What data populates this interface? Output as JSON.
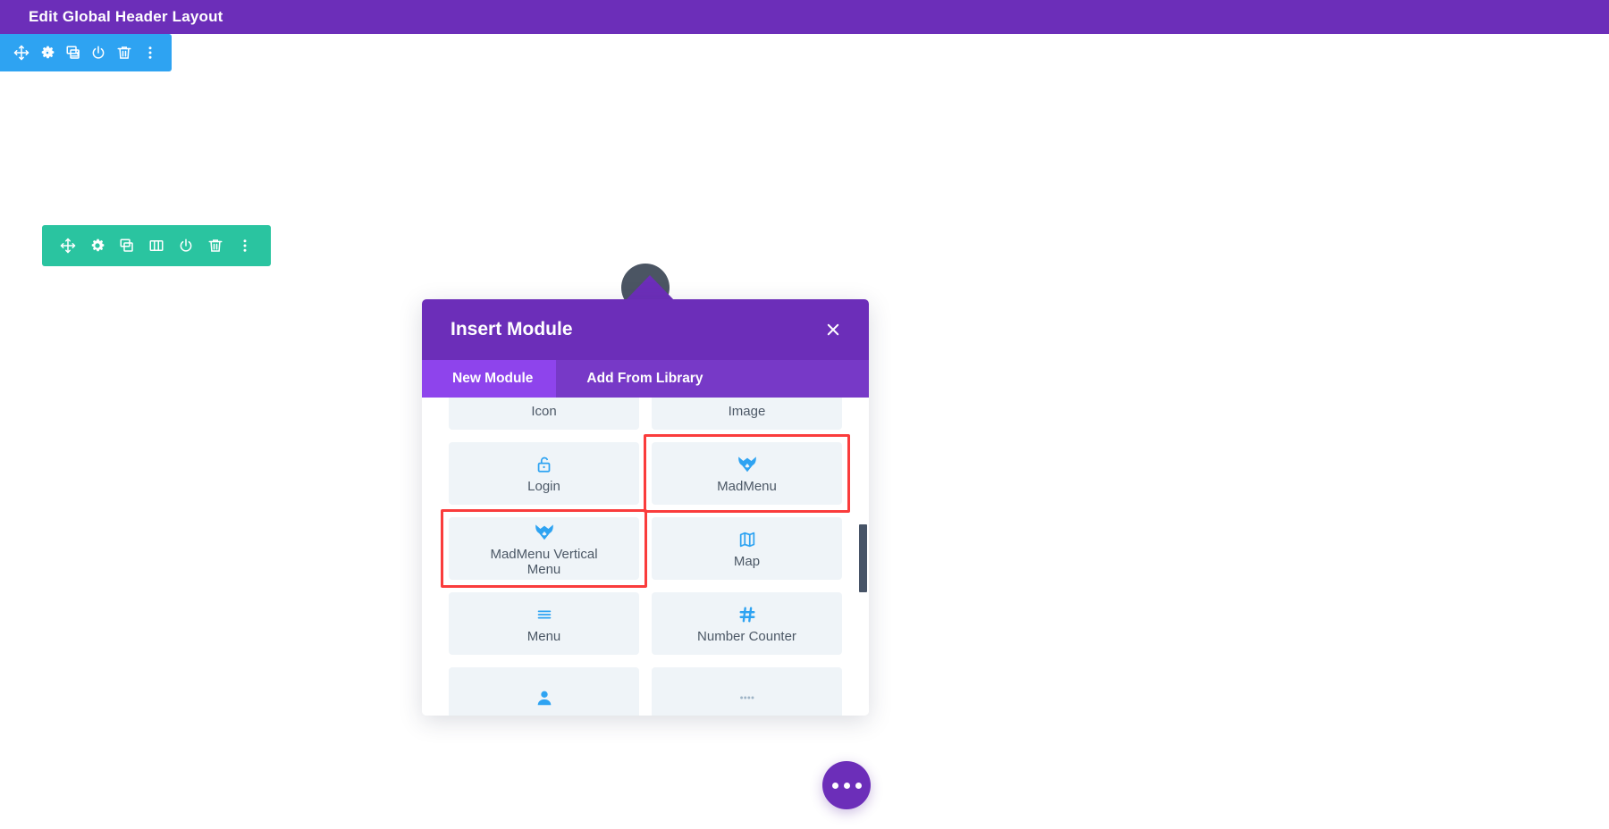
{
  "admin_bar": {
    "title": "Edit Global Header Layout",
    "background": "#6C2EB9"
  },
  "section_toolbar": {
    "color": "#2EA3F2",
    "buttons": [
      {
        "name": "move-icon",
        "label": "Move"
      },
      {
        "name": "gear-icon",
        "label": "Settings"
      },
      {
        "name": "duplicate-icon",
        "label": "Duplicate"
      },
      {
        "name": "power-icon",
        "label": "Disable"
      },
      {
        "name": "trash-icon",
        "label": "Delete"
      },
      {
        "name": "kebab-icon",
        "label": "More options"
      }
    ]
  },
  "row_toolbar": {
    "color": "#2AC4A0",
    "buttons": [
      {
        "name": "move-icon",
        "label": "Move"
      },
      {
        "name": "gear-icon",
        "label": "Settings"
      },
      {
        "name": "duplicate-icon",
        "label": "Duplicate"
      },
      {
        "name": "columns-icon",
        "label": "Change column structure"
      },
      {
        "name": "power-icon",
        "label": "Disable"
      },
      {
        "name": "trash-icon",
        "label": "Delete"
      },
      {
        "name": "kebab-icon",
        "label": "More options"
      }
    ]
  },
  "add_module_circle": {
    "name": "add-module-plus-icon",
    "glyph": "+"
  },
  "modal": {
    "title": "Insert Module",
    "close_label": "×",
    "accent": "#6C2EB9",
    "tabs": [
      {
        "label": "New Module",
        "active": true
      },
      {
        "label": "Add From Library",
        "active": false
      }
    ],
    "modules": [
      {
        "label": "Icon",
        "icon": "icon-circle-icon",
        "highlight": false
      },
      {
        "label": "Image",
        "icon": "image-icon",
        "highlight": false
      },
      {
        "label": "Login",
        "icon": "lock-open-icon",
        "highlight": false
      },
      {
        "label": "MadMenu",
        "icon": "madmenu-bat-icon",
        "highlight": true
      },
      {
        "label": "MadMenu Vertical Menu",
        "icon": "madmenu-bat-icon",
        "highlight": true
      },
      {
        "label": "Map",
        "icon": "map-icon",
        "highlight": false
      },
      {
        "label": "Menu",
        "icon": "hamburger-icon",
        "highlight": false
      },
      {
        "label": "Number Counter",
        "icon": "hash-icon",
        "highlight": false
      },
      {
        "label": "",
        "icon": "person-icon",
        "highlight": false
      },
      {
        "label": "",
        "icon": "dots-icon",
        "highlight": false
      }
    ],
    "highlight_color": "#fa3c3c"
  },
  "fab": {
    "name": "editor-options-fab",
    "label": "Editor options"
  }
}
